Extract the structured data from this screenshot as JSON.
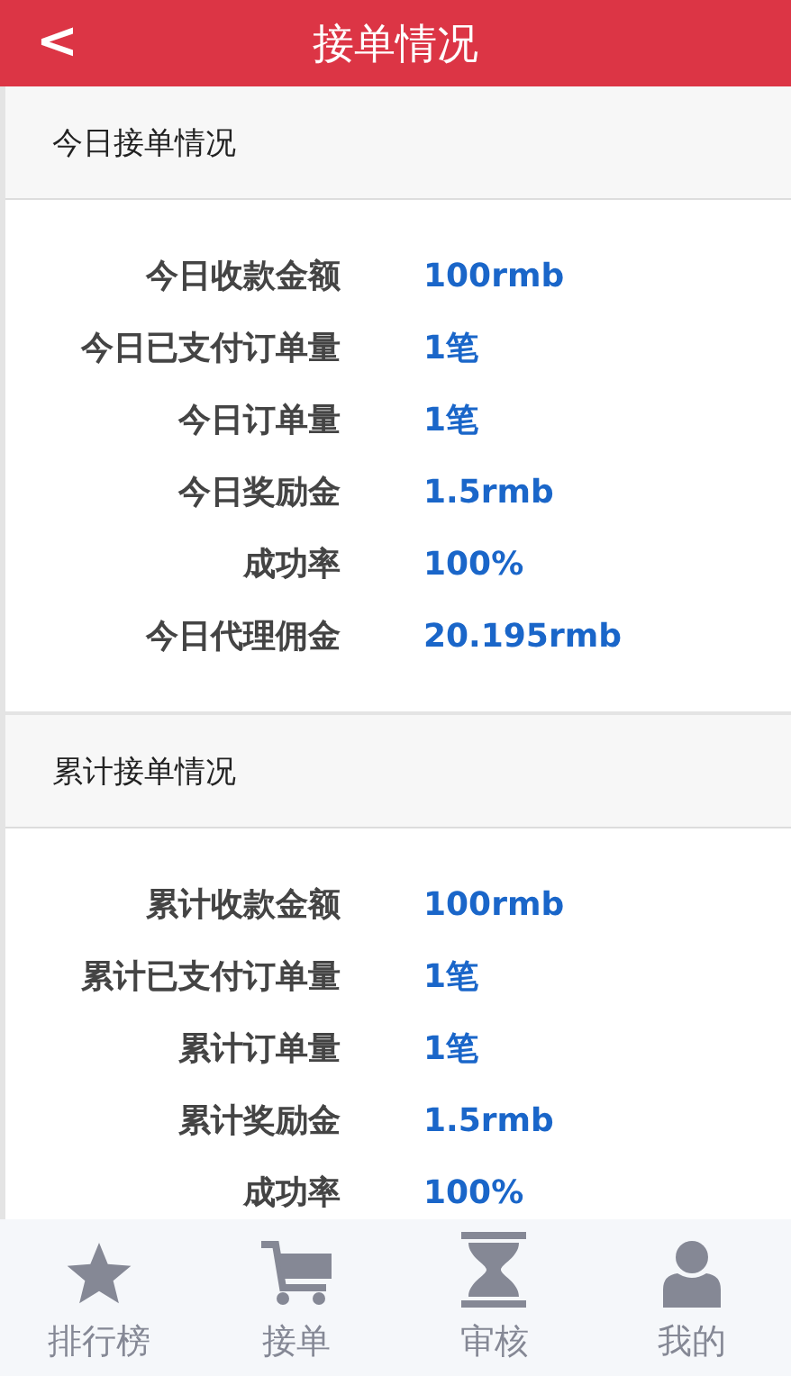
{
  "header": {
    "back": "<",
    "title": "接单情况"
  },
  "sections": [
    {
      "title": "今日接单情况",
      "rows": [
        {
          "label": "今日收款金额",
          "value": "100rmb"
        },
        {
          "label": "今日已支付订单量",
          "value": "1笔"
        },
        {
          "label": "今日订单量",
          "value": "1笔"
        },
        {
          "label": "今日奖励金",
          "value": "1.5rmb"
        },
        {
          "label": "成功率",
          "value": "100%"
        },
        {
          "label": "今日代理佣金",
          "value": "20.195rmb"
        }
      ]
    },
    {
      "title": "累计接单情况",
      "rows": [
        {
          "label": "累计收款金额",
          "value": "100rmb"
        },
        {
          "label": "累计已支付订单量",
          "value": "1笔"
        },
        {
          "label": "累计订单量",
          "value": "1笔"
        },
        {
          "label": "累计奖励金",
          "value": "1.5rmb"
        },
        {
          "label": "成功率",
          "value": "100%"
        }
      ]
    }
  ],
  "tab_bar": [
    {
      "kind": "star",
      "label": "排行榜"
    },
    {
      "kind": "cart",
      "label": "接单"
    },
    {
      "kind": "hourglass",
      "label": "审核"
    },
    {
      "kind": "user",
      "label": "我的"
    }
  ]
}
